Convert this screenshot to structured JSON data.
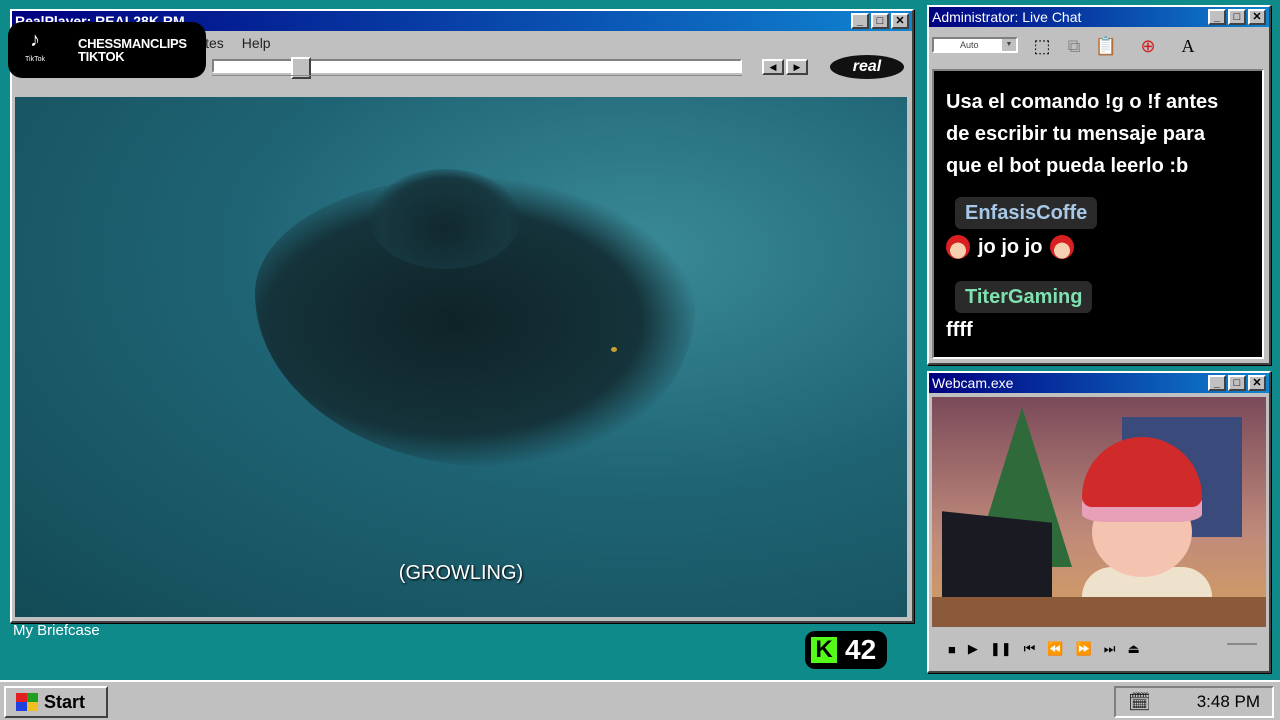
{
  "player": {
    "title": "RealPlayer: REAL28K.RM",
    "menu": [
      "ites",
      "Help"
    ],
    "logo_text": "real",
    "seek_fraction": 0.15,
    "caption": "(GROWLING)"
  },
  "watermark": {
    "platform": "TikTok",
    "handle_line1": "CHESSMANCLIPS",
    "handle_line2": "TIKTOK"
  },
  "desktop": {
    "label": "My Briefcase"
  },
  "kick": {
    "letter": "K",
    "count": "42",
    "accent": "#53fc18"
  },
  "chat": {
    "title": "Administrator: Live Chat",
    "font_combo": "Auto",
    "system_message": "Usa el comando !g o !f antes de escribir tu mensaje para que el bot pueda leerlo :b",
    "messages": [
      {
        "user": "EnfasisCoffe",
        "user_color": "#a8c8e8",
        "text": "jo jo jo"
      },
      {
        "user": "TiterGaming",
        "user_color": "#7fe0b0",
        "text": "ffff"
      }
    ]
  },
  "webcam": {
    "title": "Webcam.exe",
    "controls": [
      "■",
      "▶",
      "❚❚",
      "⏮",
      "⏪",
      "⏩",
      "⏭",
      "⏏"
    ]
  },
  "taskbar": {
    "start_label": "Start",
    "clock": "3:48 PM"
  }
}
